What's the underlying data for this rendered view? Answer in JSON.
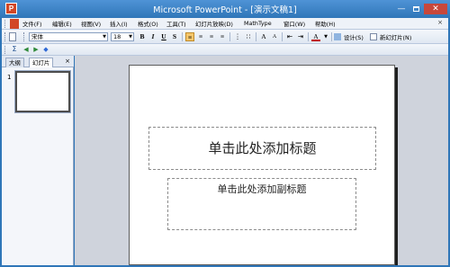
{
  "window": {
    "title": "Microsoft PowerPoint - [演示文稿1]",
    "min_glyph": "—",
    "close_glyph": "✕"
  },
  "menubar": {
    "items": [
      "文件(F)",
      "编辑(E)",
      "视图(V)",
      "插入(I)",
      "格式(O)",
      "工具(T)",
      "幻灯片放映(D)",
      "MathType",
      "窗口(W)",
      "帮助(H)"
    ],
    "right_glyph": "×"
  },
  "toolbar": {
    "font_name": "宋体",
    "font_size": "18",
    "bold": "B",
    "italic": "I",
    "underline": "U",
    "shadow": "S",
    "design_label": "设计(S)",
    "new_slide_label": "新幻灯片(N)"
  },
  "left_pane": {
    "tabs": [
      "大纲",
      "幻灯片"
    ],
    "close_glyph": "×",
    "slide_number": "1"
  },
  "slide": {
    "title_placeholder": "单击此处添加标题",
    "subtitle_placeholder": "单击此处添加副标题"
  },
  "colors": {
    "frame": "#2f76b8",
    "workspace": "#cfd3dc",
    "active_button": "#f5c76b"
  }
}
